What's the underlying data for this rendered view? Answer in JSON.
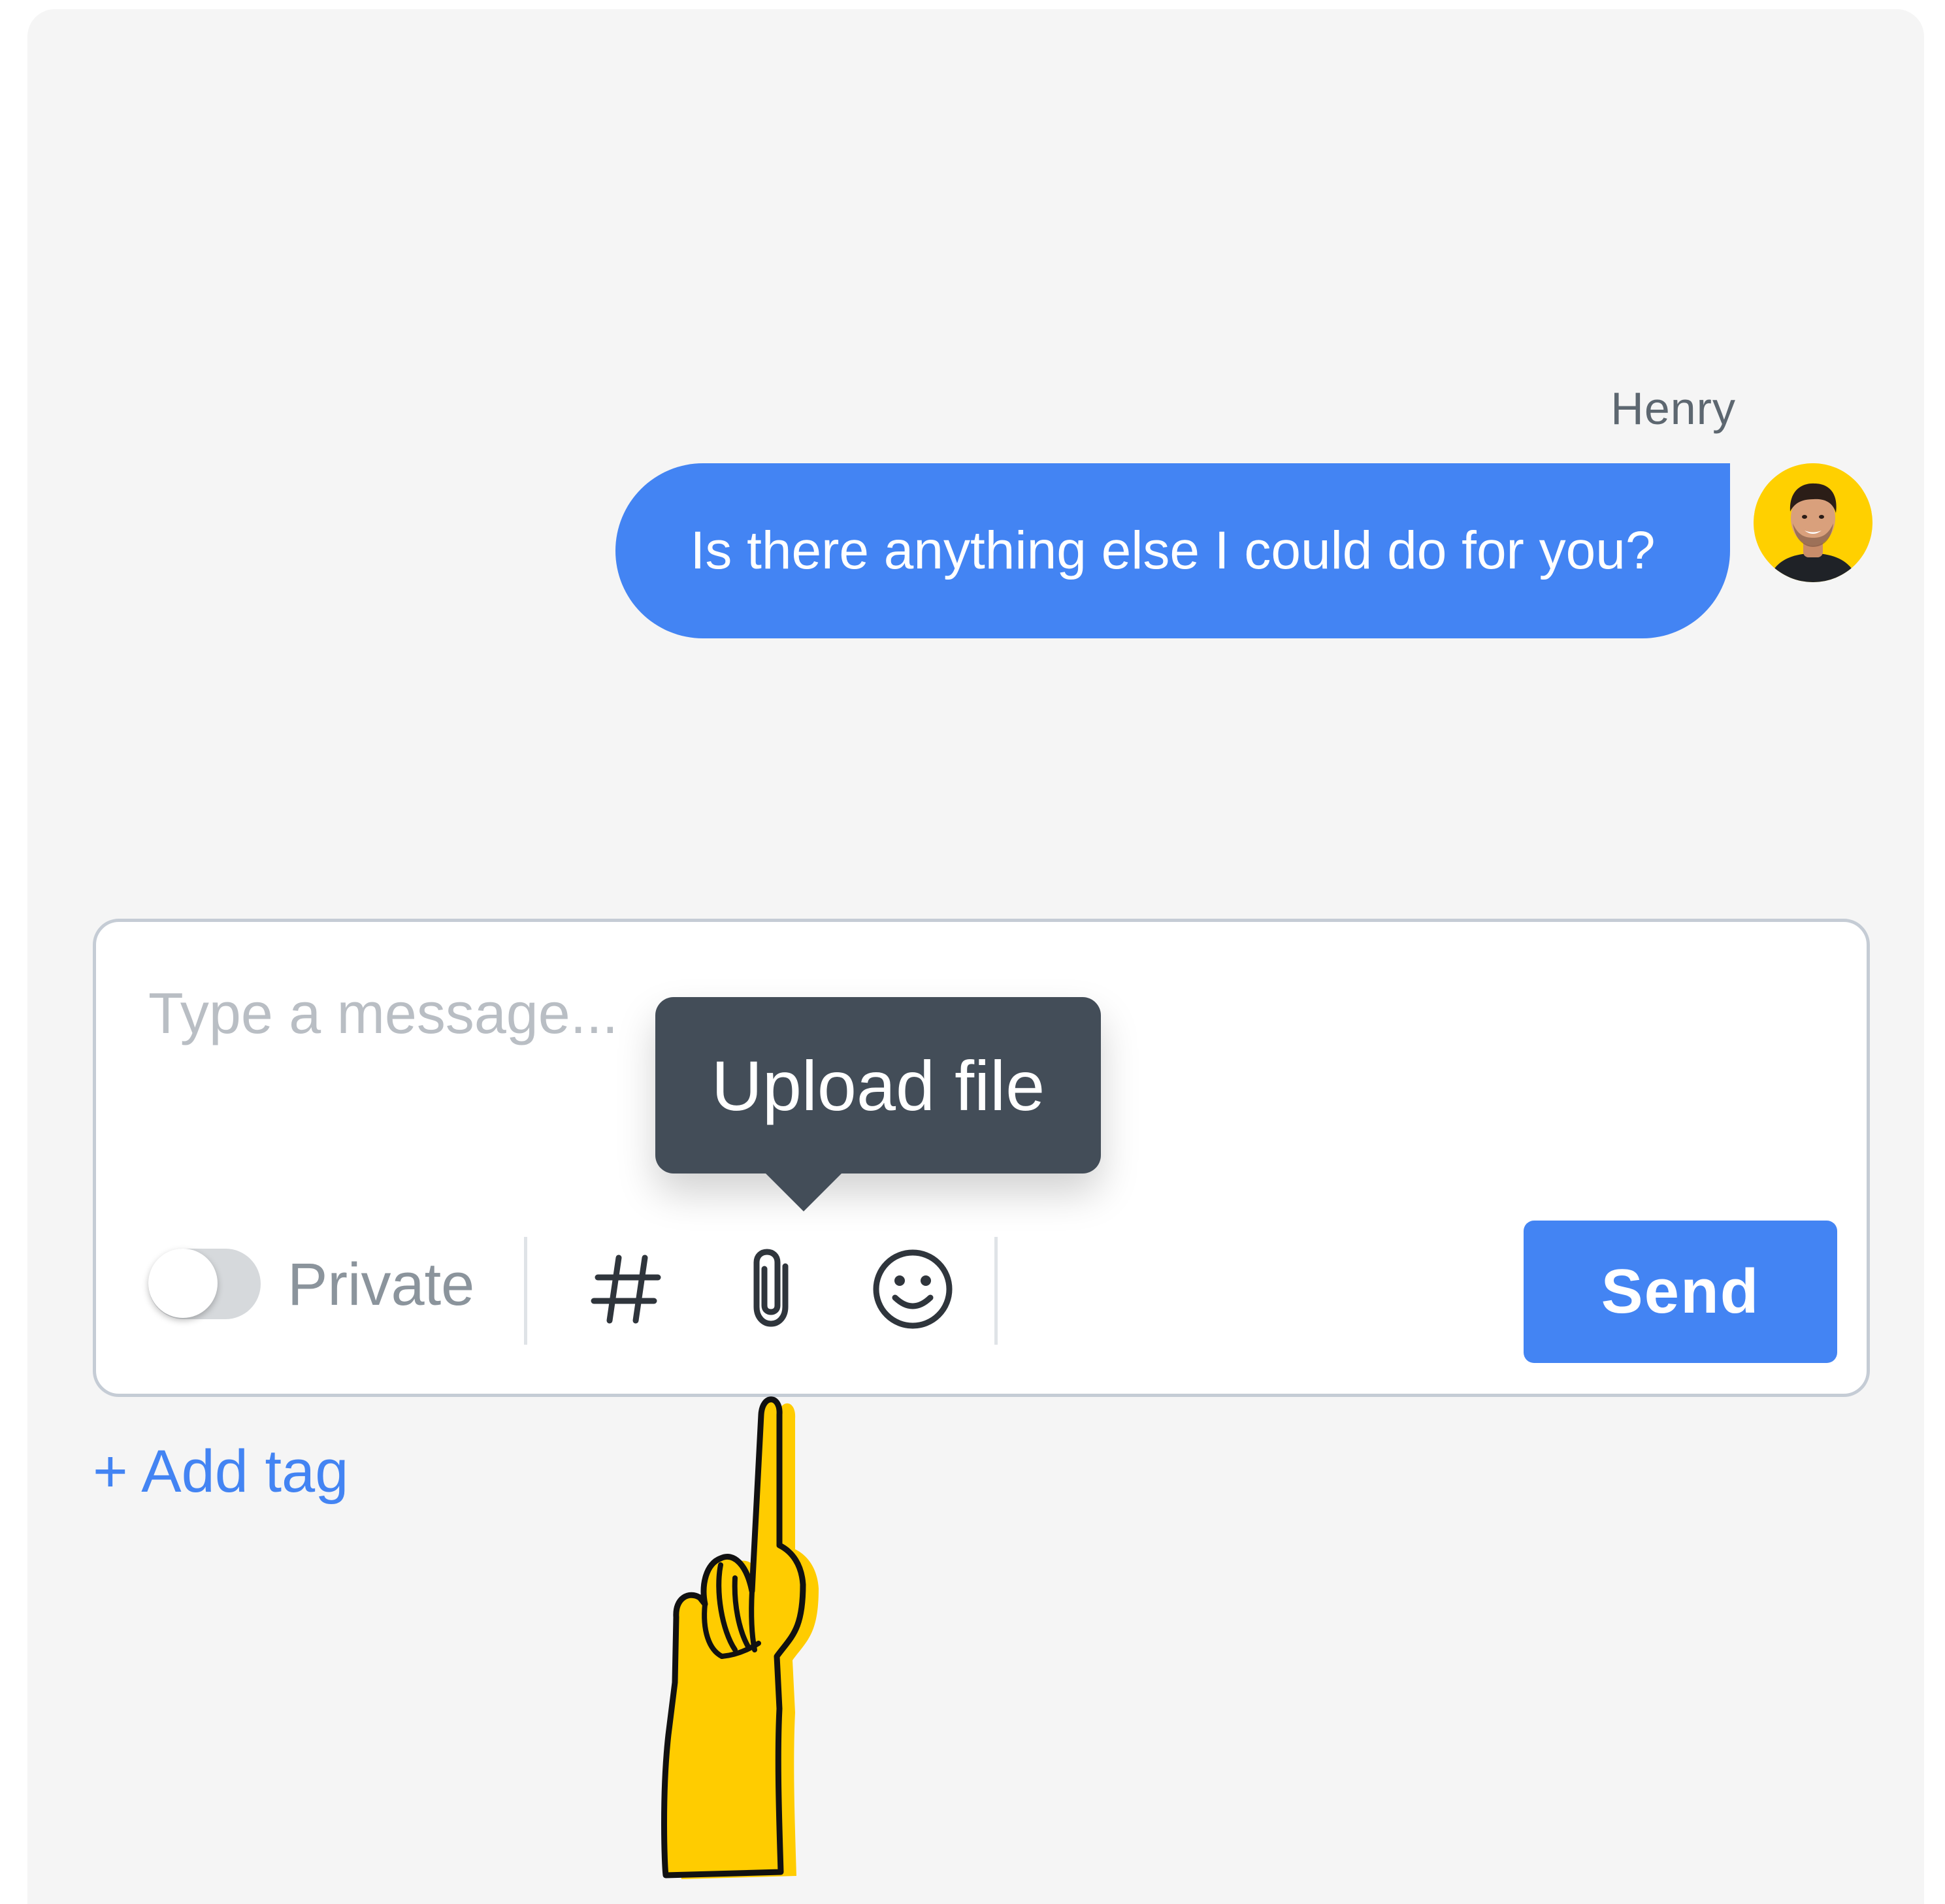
{
  "conversation": {
    "sender_name": "Henry",
    "message_text": "Is there anything else I could do for you?"
  },
  "composer": {
    "placeholder": "Type a message...",
    "private_label": "Private",
    "private_enabled": false,
    "tools": [
      "hashtag-icon",
      "paperclip-icon",
      "smiley-icon"
    ],
    "send_label": "Send",
    "tooltip": "Upload file"
  },
  "add_tag_label": "+ Add tag",
  "colors": {
    "accent": "#4384f3",
    "panel_background": "#f5f5f5",
    "tooltip_background": "#434d58",
    "avatar_background": "#ffd000",
    "hand_fill": "#ffcc00"
  }
}
